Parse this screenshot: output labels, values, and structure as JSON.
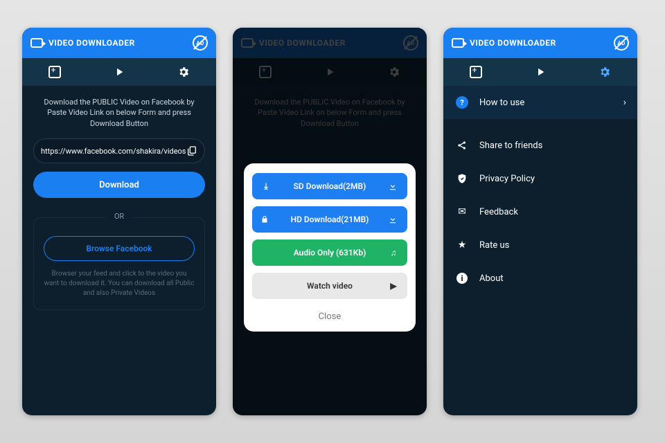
{
  "app_title": "VIDEO DOWNLOADER",
  "screen1": {
    "instruction": "Download the PUBLIC Video on Facebook by Paste Video Link on below Form and press Download Button",
    "url_value": "https://www.facebook.com/shakira/videos",
    "download_label": "Download",
    "or_label": "OR",
    "browse_label": "Browse Facebook",
    "browse_hint": "Browser your feed and click to the video you want to download it. You can download all Public and also Private Videos"
  },
  "screen2": {
    "options": [
      {
        "label": "SD Download(2MB)",
        "left_icon": "download-icon",
        "right_icon": "download-arrow-icon",
        "style": "blue"
      },
      {
        "label": "HD Download(21MB)",
        "left_icon": "lock-icon",
        "right_icon": "download-arrow-icon",
        "style": "blue"
      },
      {
        "label": "Audio Only (631Kb)",
        "left_icon": "",
        "right_icon": "music-icon",
        "style": "green"
      },
      {
        "label": "Watch video",
        "left_icon": "",
        "right_icon": "play-icon",
        "style": "grey"
      }
    ],
    "close_label": "Close"
  },
  "screen3": {
    "items": [
      {
        "icon": "question-icon",
        "label": "How to use",
        "highlight": true,
        "chevron": true
      },
      {
        "icon": "share-icon",
        "label": "Share to friends"
      },
      {
        "icon": "shield-icon",
        "label": "Privacy Policy"
      },
      {
        "icon": "mail-icon",
        "label": "Feedback"
      },
      {
        "icon": "star-icon",
        "label": "Rate us"
      },
      {
        "icon": "info-icon",
        "label": "About"
      }
    ]
  },
  "icons": {
    "ad": "AD",
    "paste": "⎘",
    "download_arrow": "⬇",
    "lock": "🔒",
    "music": "♫",
    "play": "▶",
    "share": "❮",
    "shield": "🛡",
    "mail": "✉",
    "star": "★",
    "chev": "›",
    "question": "?",
    "info": "i",
    "download_left": "⤓"
  }
}
